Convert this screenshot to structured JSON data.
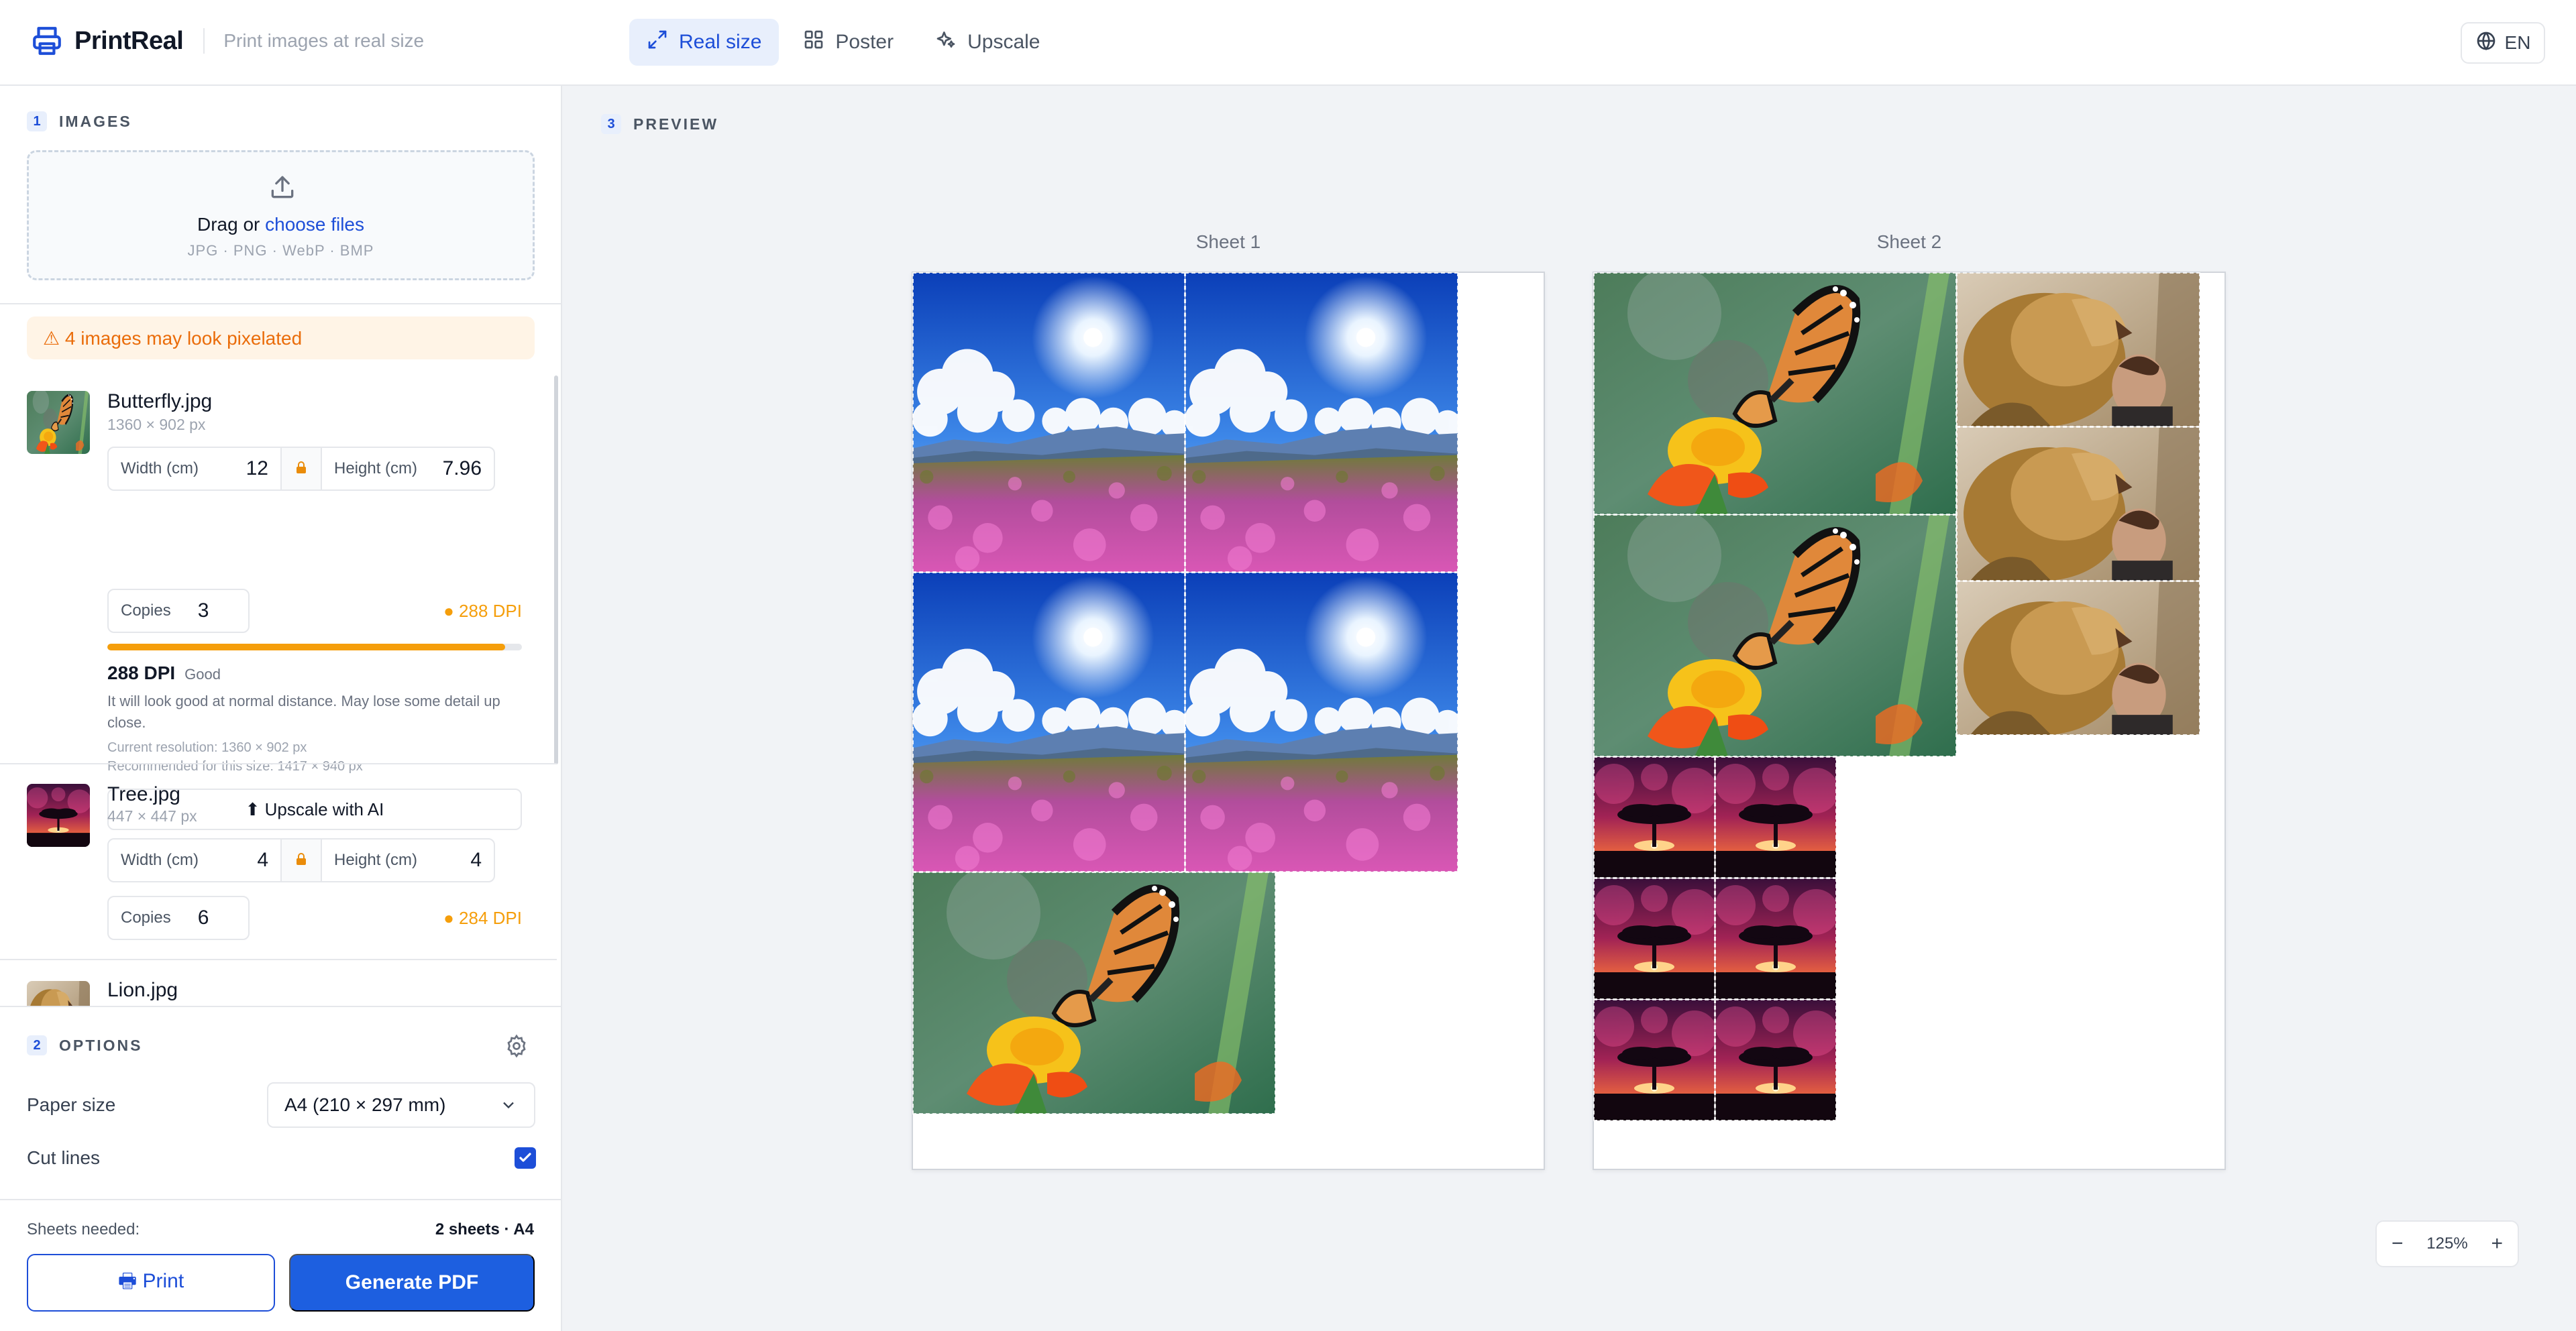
{
  "app": {
    "name": "PrintReal",
    "tagline": "Print images at real size"
  },
  "modes": [
    {
      "label": "Real size",
      "icon": "expand-arrows-icon",
      "active": true
    },
    {
      "label": "Poster",
      "icon": "grid-icon",
      "active": false
    },
    {
      "label": "Upscale",
      "icon": "sparkle-icon",
      "active": false
    }
  ],
  "language": "EN",
  "images_section": {
    "step": "1",
    "title": "IMAGES",
    "drop_text": "Drag or",
    "drop_link": "choose files",
    "formats": "JPG · PNG · WebP · BMP"
  },
  "warning": "⚠ 4 images may look pixelated",
  "images": [
    {
      "name": "Butterfly.jpg",
      "dims": "1360 × 902 px",
      "width_label": "Width (cm)",
      "width": "12",
      "height_label": "Height (cm)",
      "height": "7.96",
      "copies_label": "Copies",
      "copies": "3",
      "dpi_badge": "● 288 DPI",
      "dpi_fraction": 0.96,
      "dpi_title": "288 DPI",
      "dpi_quality": "Good",
      "dpi_desc": "It will look good at normal distance. May lose some detail up close.",
      "current_res": "Current resolution: 1360 × 902 px",
      "recommended": "Recommended for this size: 1417 × 940 px",
      "upscale_label": "⬆ Upscale with AI"
    },
    {
      "name": "Tree.jpg",
      "dims": "447 × 447 px",
      "width_label": "Width (cm)",
      "width": "4",
      "height_label": "Height (cm)",
      "height": "4",
      "copies_label": "Copies",
      "copies": "6",
      "dpi_badge": "● 284 DPI"
    },
    {
      "name": "Lion.jpg"
    }
  ],
  "options": {
    "step": "2",
    "title": "OPTIONS",
    "paper_label": "Paper size",
    "paper_value": "A4 (210 × 297 mm)",
    "cut_lines_label": "Cut lines",
    "cut_lines": true
  },
  "footer": {
    "sheets_label": "Sheets needed:",
    "sheets_value": "2 sheets · A4",
    "print_label": "🖶 Print",
    "pdf_label": "Generate PDF"
  },
  "preview": {
    "step": "3",
    "title": "PREVIEW",
    "sheets": [
      {
        "label": "Sheet 1"
      },
      {
        "label": "Sheet 2"
      }
    ]
  },
  "zoom": {
    "minus": "−",
    "level": "125%",
    "plus": "+"
  },
  "colors": {
    "accent": "#1d4ed8",
    "warning": "#ea6c0a",
    "dpi_ok": "#f59e0b"
  }
}
